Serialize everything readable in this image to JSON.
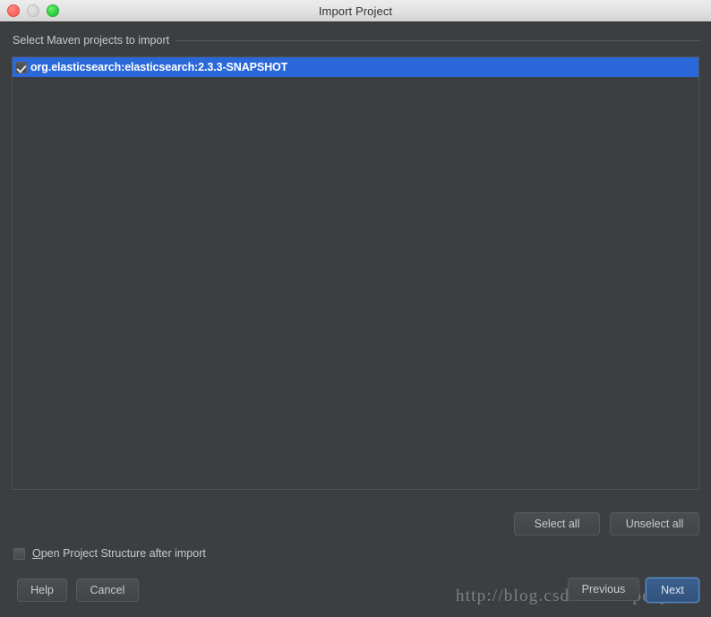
{
  "window": {
    "title": "Import Project",
    "controls": {
      "close": "close-button",
      "minimize": "minimize-button",
      "maximize": "maximize-button"
    }
  },
  "section": {
    "title": "Select Maven projects to import"
  },
  "projects": {
    "items": [
      {
        "label": "org.elasticsearch:elasticsearch:2.3.3-SNAPSHOT",
        "checked": true,
        "selected": true
      }
    ]
  },
  "list_actions": {
    "select_all": "Select all",
    "unselect_all": "Unselect all"
  },
  "options": {
    "open_structure": {
      "mnemonic": "O",
      "rest": "pen Project Structure after import",
      "checked": false
    }
  },
  "footer": {
    "help": "Help",
    "cancel": "Cancel",
    "previous": "Previous",
    "next": "Next"
  },
  "watermark": {
    "text": "http://blog.csdn.net/napoay"
  },
  "colors": {
    "dialog_background": "#3c3f41",
    "selection_blue": "#2b68d9",
    "titlebar_light": "#e3e3e3",
    "text_primary": "#c8cacb",
    "next_accent": "#5b8fd0"
  }
}
